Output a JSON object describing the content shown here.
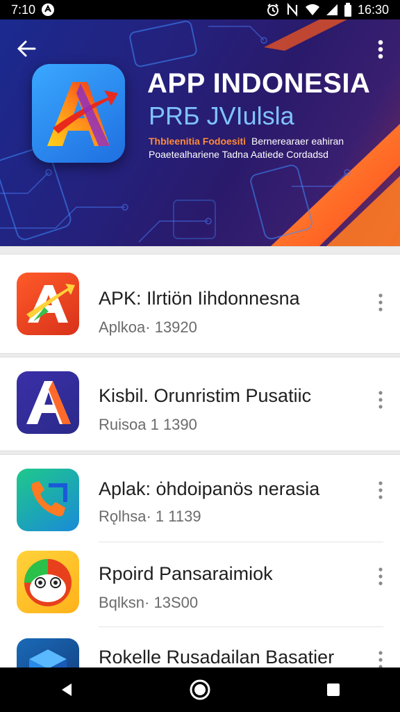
{
  "status_bar": {
    "time_left": "7:10",
    "time_right": "16:30",
    "icons": [
      "app-notification-icon",
      "alarm-icon",
      "nfc-icon",
      "wifi-icon",
      "signal-icon",
      "battery-icon"
    ]
  },
  "banner": {
    "title": "APP INDONESIA",
    "subtitle": "PRБ JVIulslа",
    "line1_highlight": "Thbleenitia Fodoesiti",
    "line1_rest": "Bernerearaer eahiran",
    "line2": "Poaetealhariene Tadna Aatiede Cordadsd",
    "colors": {
      "accent_orange": "#ff6a1a",
      "title": "#ffffff",
      "subtitle": "#7fc3ff"
    }
  },
  "list": {
    "items": [
      {
        "title": "APK: Ilrtiön Iihdonnesna",
        "subtitle": "Aplkoa· 13920",
        "icon": "apk-logo-icon"
      },
      {
        "title": "Kisbil. Orunristim Pusatiic",
        "subtitle": "Ruisoa  1 1390",
        "icon": "letter-a-logo-icon"
      },
      {
        "title": "Aplak: ȯhdoipanös nerasia",
        "subtitle": "Rǫlhsa· 1 1139",
        "icon": "phone-logo-icon"
      },
      {
        "title": "Rpoird Pansaraimiok",
        "subtitle": "Bqlksn· 13Ѕ00",
        "icon": "face-logo-icon"
      },
      {
        "title": "Rokelle Rusadailan Basatier",
        "subtitle": "",
        "icon": "cube-logo-icon"
      }
    ]
  },
  "nav_bar": {
    "buttons": [
      "back-triangle-icon",
      "home-circle-icon",
      "recents-square-icon"
    ]
  }
}
